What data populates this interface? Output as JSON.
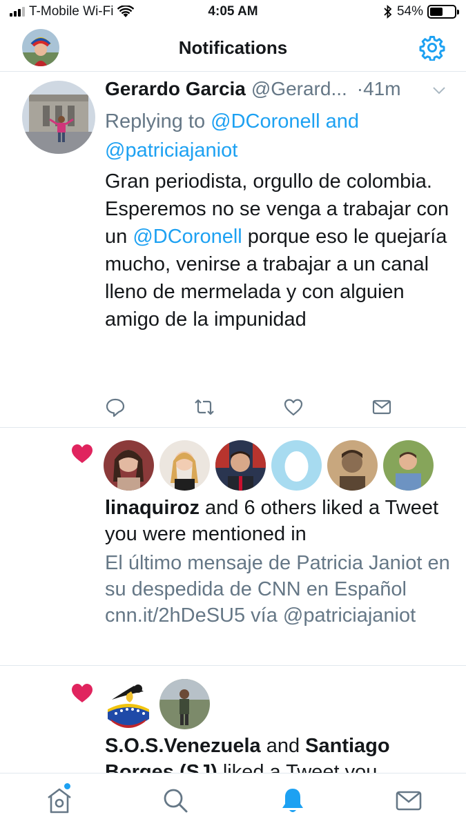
{
  "status_bar": {
    "carrier": "T-Mobile Wi-Fi",
    "time": "4:05 AM",
    "battery_percent": "54%",
    "battery_level": 0.54
  },
  "header": {
    "title": "Notifications"
  },
  "tweet": {
    "author_name": "Gerardo Garcia",
    "author_handle": "@Gerard...",
    "time": "·41m",
    "reply_prefix": "Replying to ",
    "reply_mention_1": "@DCoronell",
    "reply_and": " and ",
    "reply_mention_2": "@patriciajaniot",
    "body_part1": "Gran periodista, orgullo de colombia. Esperemos no se venga a trabajar con un ",
    "body_mention": "@DCoronell",
    "body_part2": " porque eso le quejaría mucho, venirse a trabajar a un canal lleno de mermelada  y con alguien amigo de la impunidad"
  },
  "notifications": [
    {
      "actor": "linaquiroz",
      "text": " and 6 others liked a Tweet you were mentioned in",
      "preview": "El último mensaje de Patricia Janiot en su despedida de CNN en Español cnn.it/2hDeSU5 vía @patriciajaniot",
      "avatar_count": 6
    },
    {
      "actor": "S.O.S.Venezuela",
      "and": " and ",
      "actor2": "Santiago Borges (SJ)",
      "text": " liked a Tweet you",
      "avatar_count": 2
    }
  ],
  "colors": {
    "accent": "#1da1f2",
    "like": "#e0245e",
    "secondary_text": "#657786",
    "divider": "#e1e8ed"
  },
  "icons": {
    "status": [
      "signal-icon",
      "wifi-icon",
      "bluetooth-icon",
      "battery-icon"
    ],
    "header": [
      "gear-icon"
    ],
    "tweet_actions": [
      "reply-icon",
      "retweet-icon",
      "like-icon",
      "direct-message-icon"
    ],
    "tabs": [
      "home-icon",
      "search-icon",
      "notifications-bell-icon",
      "messages-icon"
    ]
  }
}
